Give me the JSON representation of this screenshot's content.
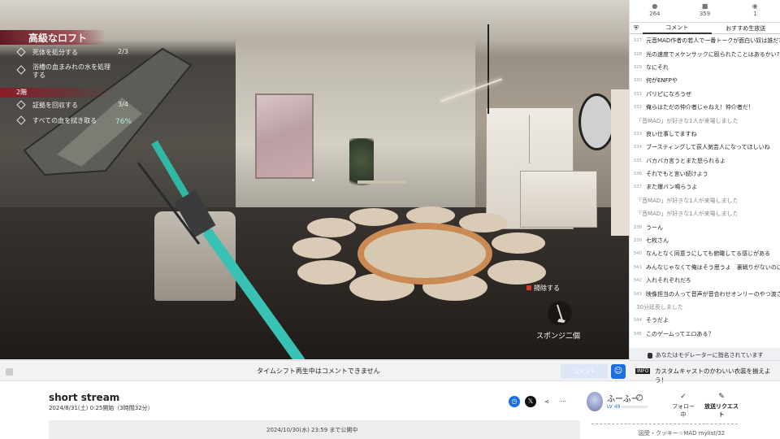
{
  "video": {
    "quest_title": "高級なロフト",
    "quests_top": [
      {
        "label": "死体を処分する",
        "count": "2/3"
      },
      {
        "label": "浴槽の血まみれの水を処理する",
        "count": ""
      }
    ],
    "floor_label": "2階",
    "quests_floor": [
      {
        "label": "証拠を回収する",
        "count": "3/4"
      },
      {
        "label": "すべての血を拭き取る",
        "count": ""
      }
    ],
    "mop_percent": "76%",
    "prompt": "掃除する",
    "tool_name": "スポンジ二個"
  },
  "stats": [
    {
      "icon": "person-icon",
      "value": "264"
    },
    {
      "icon": "chat-icon",
      "value": "359"
    },
    {
      "icon": "ad-icon",
      "value": "1"
    }
  ],
  "tabs": {
    "comments": "コメント",
    "recommended": "おすすめ生放送"
  },
  "comments": [
    {
      "no": "",
      "text": "元音MAD作者の若人で一番トークが面白い奴は誰だ?",
      "sys": false,
      "no_label": "327"
    },
    {
      "no": "328",
      "text": "光の速度でメケンサックに殴られたことはあるかい?",
      "sys": false
    },
    {
      "no": "329",
      "text": "なにそれ",
      "sys": false
    },
    {
      "no": "330",
      "text": "何がENFPや",
      "sys": false
    },
    {
      "no": "331",
      "text": "パリピになろうぜ",
      "sys": false
    },
    {
      "no": "332",
      "text": "俺らはただの仲介者じゃねえ！仲介者だ！",
      "sys": false
    },
    {
      "no": "",
      "text": "「音MAD」が好きな1人が来場しました",
      "sys": true
    },
    {
      "no": "333",
      "text": "良い仕事してますね",
      "sys": false
    },
    {
      "no": "334",
      "text": "ブースティングして荻人気芸人になってほしいね",
      "sys": false
    },
    {
      "no": "335",
      "text": "バカバカ言うとまた怒られるよ",
      "sys": false
    },
    {
      "no": "336",
      "text": "それでもと言い続けよう",
      "sys": false
    },
    {
      "no": "337",
      "text": "また爆バン鳴らうよ",
      "sys": false
    },
    {
      "no": "",
      "text": "「音MAD」が好きな1人が来場しました",
      "sys": true
    },
    {
      "no": "",
      "text": "「音MAD」が好きな1人が来場しました",
      "sys": true
    },
    {
      "no": "338",
      "text": "うーん",
      "sys": false
    },
    {
      "no": "339",
      "text": "七枚さん",
      "sys": false
    },
    {
      "no": "340",
      "text": "なんとなく同意うにしても俯瞰してる感じがある",
      "sys": false
    },
    {
      "no": "341",
      "text": "みんなじゃなくて俺はそう思うよ　裏戦りがないのに主観で",
      "sys": false
    },
    {
      "no": "342",
      "text": "入れそれぞれだろ",
      "sys": false
    },
    {
      "no": "343",
      "text": "映像担当の人って音声が音合わせオンリーのやつ渡されたら",
      "sys": false
    },
    {
      "no": "",
      "text": "30分延長しました",
      "sys": true
    },
    {
      "no": "344",
      "text": "そうだよ",
      "sys": false
    },
    {
      "no": "345",
      "text": "このゲームってエロある？",
      "sys": false
    }
  ],
  "moderator_note": "あなたはモデレーターに指名されています",
  "bar": {
    "message": "タイムシフト再生中はコメントできません",
    "comment_button": "コメント",
    "info_tag": "INFO",
    "info_text": "カスタムキャストのかわいい衣装を揃えよう！"
  },
  "stream": {
    "title": "short stream",
    "date": "2024/8/31(土) 0:25開始（3時間32分）",
    "public_until": "2024/10/30(水) 23:59 まで公開中"
  },
  "user": {
    "name": "ふーふー",
    "level": "LV 49",
    "follow": "フォロー中",
    "request": "放送リクエスト",
    "mylist": "図受・クッキー☆MAD mylist/32"
  }
}
